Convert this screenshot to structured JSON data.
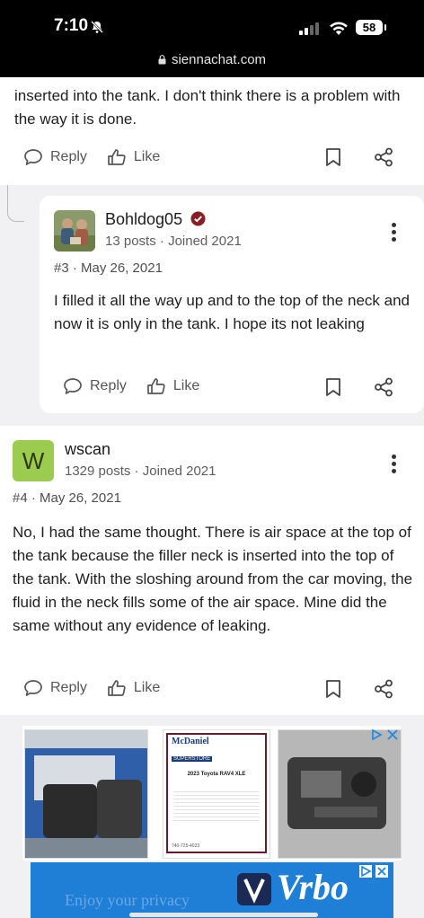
{
  "status_bar": {
    "time": "7:10",
    "battery": "58"
  },
  "browser": {
    "url": "siennachat.com"
  },
  "top_post": {
    "text": "inserted into the tank. I don't think there is a problem with the way it is done."
  },
  "actions": {
    "reply_label": "Reply",
    "like_label": "Like"
  },
  "post3": {
    "username": "Bohldog05",
    "posts": "13 posts",
    "joined": "Joined 2021",
    "number": "#3",
    "date": "May 26, 2021",
    "text": "I filled it all the way up and to the top of the neck and now it is only in the tank. I hope its not leaking"
  },
  "post4": {
    "avatar_letter": "W",
    "username": "wscan",
    "posts": "1329 posts",
    "joined": "Joined 2021",
    "number": "#4",
    "date": "May 26, 2021",
    "text": "No, I had the same thought. There is air space at the top of the tank because the filler neck is inserted into the top of the tank. With the sloshing around from the car moving, the fluid in the neck fills some of the air space. Mine did the same without any evidence of leaking."
  },
  "ads": {
    "dealer_name": "McDaniel",
    "dealer_sub": "SUPERSTORE",
    "dealer_car": "2023 Toyota RAV4 XLE",
    "dealer_phone": "1-740-389-6333",
    "dealer_phone_small": "740-725-4023",
    "vrbo_brand": "Vrbo",
    "vrbo_text": "Enjoy your privacy"
  },
  "colors": {
    "accent": "#9ccc4f",
    "verified": "#8b1c24",
    "ad_blue": "#1f7fd6"
  },
  "icons": [
    "bell-slash-icon",
    "wifi-icon",
    "lock-icon",
    "reply-bubble-icon",
    "thumbs-up-icon",
    "bookmark-icon",
    "share-icon",
    "verified-badge-icon",
    "more-options-icon",
    "ad-choices-icon",
    "close-icon"
  ]
}
